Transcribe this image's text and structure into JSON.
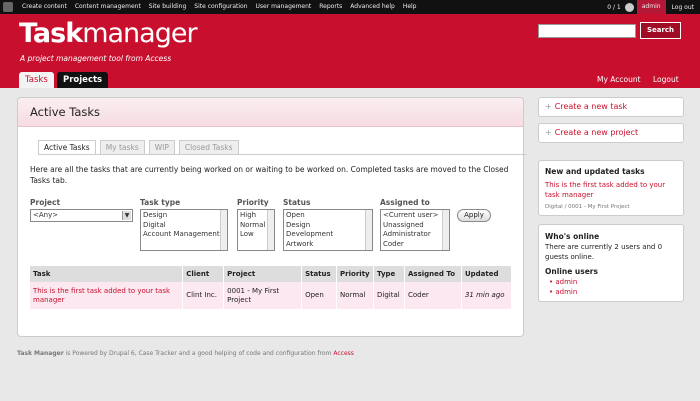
{
  "admin_bar": {
    "menu": [
      "Create content",
      "Content management",
      "Site building",
      "Site configuration",
      "User management",
      "Reports",
      "Advanced help",
      "Help"
    ],
    "counter": "0 / 1",
    "user": "admin",
    "logout": "Log out"
  },
  "header": {
    "brand_bold": "Task",
    "brand_light": "manager",
    "tagline": "A project management tool from Access",
    "search_label": "Search",
    "tabs": [
      "Tasks",
      "Projects"
    ],
    "links": [
      "My Account",
      "Logout"
    ]
  },
  "main": {
    "title": "Active Tasks",
    "subtabs": [
      "Active Tasks",
      "My tasks",
      "WIP",
      "Closed Tasks"
    ],
    "intro": "Here are all the tasks that are currently being worked on or waiting to be worked on. Completed tasks are moved to the Closed Tasks tab.",
    "filters": {
      "project": {
        "label": "Project",
        "value": "<Any>"
      },
      "task_type": {
        "label": "Task type",
        "options": [
          "Design",
          "Digital",
          "Account Management"
        ]
      },
      "priority": {
        "label": "Priority",
        "options": [
          "High",
          "Normal",
          "Low"
        ]
      },
      "status": {
        "label": "Status",
        "options": [
          "Open",
          "Design",
          "Development",
          "Artwork"
        ]
      },
      "assigned_to": {
        "label": "Assigned to",
        "options": [
          "<Current user>",
          "Unassigned",
          "Administrator",
          "Coder"
        ]
      },
      "apply": "Apply"
    },
    "table": {
      "headers": [
        "Task",
        "Client",
        "Project",
        "Status",
        "Priority",
        "Type",
        "Assigned To",
        "Updated"
      ],
      "rows": [
        [
          "This is the first task added to your task manager",
          "Clint Inc.",
          "0001 - My First Project",
          "Open",
          "Normal",
          "Digital",
          "Coder",
          "31 min ago"
        ]
      ]
    }
  },
  "sidebar": {
    "create_task": "Create a new task",
    "create_project": "Create a new project",
    "new_updated": {
      "title": "New and updated tasks",
      "task_link": "This is the first task added to your task manager",
      "meta": "Digital / 0001 - My First Project"
    },
    "whos_online": {
      "title": "Who's online",
      "text": "There are currently 2 users and 0 guests online.",
      "online_users_title": "Online users",
      "users": [
        "admin",
        "admin"
      ]
    }
  },
  "footer": {
    "brand": "Task Manager",
    "text": " is Powered by Drupal 6, Case Tracker and a good helping of code and configuration from ",
    "link": "Access"
  }
}
